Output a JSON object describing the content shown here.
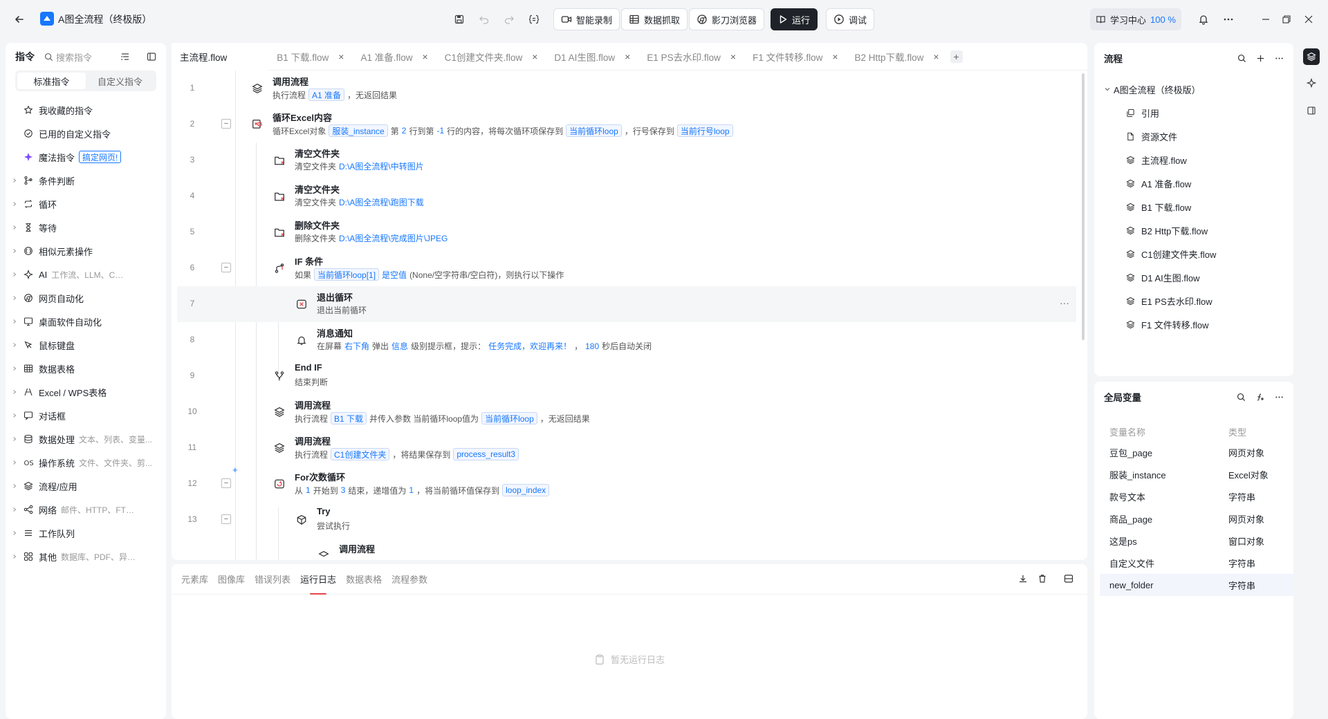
{
  "app": {
    "title": "A图全流程（终极版）",
    "toolbar": {
      "smart_record": "智能录制",
      "data_capture": "数据抓取",
      "browser": "影刀浏览器",
      "run": "运行",
      "debug": "调试"
    },
    "learn_center": "学习中心",
    "zoom": "100 %"
  },
  "left_panel": {
    "title": "指令",
    "search_placeholder": "搜索指令",
    "tabs": [
      "标准指令",
      "自定义指令"
    ],
    "categories": [
      {
        "label": "我收藏的指令",
        "icon": "star-icon",
        "sub": ""
      },
      {
        "label": "已用的自定义指令",
        "icon": "check-circle-icon",
        "sub": ""
      },
      {
        "label": "魔法指令",
        "icon": "sparkle-icon",
        "sub": "",
        "tag": "搞定网页!"
      },
      {
        "label": "条件判断",
        "icon": "branch-icon",
        "sub": ""
      },
      {
        "label": "循环",
        "icon": "loop-icon",
        "sub": ""
      },
      {
        "label": "等待",
        "icon": "hourglass-icon",
        "sub": ""
      },
      {
        "label": "相似元素操作",
        "icon": "similar-icon",
        "sub": ""
      },
      {
        "label": "AI",
        "icon": "ai-icon",
        "sub": "工作流、LLM、CUA..."
      },
      {
        "label": "网页自动化",
        "icon": "browser-icon",
        "sub": ""
      },
      {
        "label": "桌面软件自动化",
        "icon": "monitor-icon",
        "sub": ""
      },
      {
        "label": "鼠标键盘",
        "icon": "cursor-icon",
        "sub": ""
      },
      {
        "label": "数据表格",
        "icon": "table-icon",
        "sub": ""
      },
      {
        "label": "Excel / WPS表格",
        "icon": "excel-icon",
        "sub": ""
      },
      {
        "label": "对话框",
        "icon": "dialog-icon",
        "sub": ""
      },
      {
        "label": "数据处理",
        "icon": "database-icon",
        "sub": "文本、列表、变量..."
      },
      {
        "label": "操作系统",
        "icon": "os-icon",
        "sub": "文件、文件夹、剪..."
      },
      {
        "label": "流程/应用",
        "icon": "layers-icon",
        "sub": ""
      },
      {
        "label": "网络",
        "icon": "share-icon",
        "sub": "邮件、HTTP、FTP、群..."
      },
      {
        "label": "工作队列",
        "icon": "list-icon",
        "sub": ""
      },
      {
        "label": "其他",
        "icon": "grid-icon",
        "sub": "数据库、PDF、异常处..."
      }
    ]
  },
  "tabs": [
    {
      "label": "主流程.flow",
      "active": true,
      "closable": false
    },
    {
      "label": "B1 下载.flow",
      "active": false,
      "closable": true
    },
    {
      "label": "A1 准备.flow",
      "active": false,
      "closable": true
    },
    {
      "label": "C1创建文件夹.flow",
      "active": false,
      "closable": true
    },
    {
      "label": "D1 AI生图.flow",
      "active": false,
      "closable": true
    },
    {
      "label": "E1 PS去水印.flow",
      "active": false,
      "closable": true
    },
    {
      "label": "F1 文件转移.flow",
      "active": false,
      "closable": true
    },
    {
      "label": "B2 Http下载.flow",
      "active": false,
      "closable": true
    }
  ],
  "steps": [
    {
      "n": "1",
      "title": "调用流程",
      "desc": [
        [
          "t",
          "执行流程"
        ],
        [
          "tag",
          "A1 准备"
        ],
        [
          "t",
          "，无返回结果"
        ]
      ]
    },
    {
      "n": "2",
      "title": "循环Excel内容",
      "desc": [
        [
          "t",
          "循环Excel对象"
        ],
        [
          "tag",
          "服装_instance"
        ],
        [
          "t",
          "第"
        ],
        [
          "b",
          "2"
        ],
        [
          "t",
          "行到第"
        ],
        [
          "b",
          "-1"
        ],
        [
          "t",
          "行的内容，将每次循环项保存到"
        ],
        [
          "tag",
          "当前循环loop"
        ],
        [
          "t",
          "，行号保存到"
        ],
        [
          "tag",
          "当前行号loop"
        ]
      ]
    },
    {
      "n": "3",
      "title": "清空文件夹",
      "desc": [
        [
          "t",
          "清空文件夹"
        ],
        [
          "b",
          "D:\\A图全流程\\中转图片"
        ]
      ]
    },
    {
      "n": "4",
      "title": "清空文件夹",
      "desc": [
        [
          "t",
          "清空文件夹"
        ],
        [
          "b",
          "D:\\A图全流程\\跑图下载"
        ]
      ]
    },
    {
      "n": "5",
      "title": "删除文件夹",
      "desc": [
        [
          "t",
          "删除文件夹"
        ],
        [
          "b",
          "D:\\A图全流程\\完成图片\\JPEG"
        ]
      ]
    },
    {
      "n": "6",
      "title": "IF 条件",
      "desc": [
        [
          "t",
          "如果"
        ],
        [
          "tag",
          "当前循环loop[1]"
        ],
        [
          "b",
          "是空值"
        ],
        [
          "t",
          "(None/空字符串/空白符)，则执行以下操作"
        ]
      ]
    },
    {
      "n": "7",
      "title": "退出循环",
      "desc": [
        [
          "t",
          "退出当前循环"
        ]
      ]
    },
    {
      "n": "8",
      "title": "消息通知",
      "desc": [
        [
          "t",
          "在屏幕"
        ],
        [
          "b",
          "右下角"
        ],
        [
          "t",
          "弹出"
        ],
        [
          "b",
          "信息"
        ],
        [
          "t",
          "级别提示框，提示："
        ],
        [
          "b",
          "任务完成，欢迎再来！"
        ],
        [
          "t",
          "，"
        ],
        [
          "b",
          "180"
        ],
        [
          "t",
          "秒后自动关闭"
        ]
      ]
    },
    {
      "n": "9",
      "title": "End IF",
      "desc": [
        [
          "t",
          "结束判断"
        ]
      ]
    },
    {
      "n": "10",
      "title": "调用流程",
      "desc": [
        [
          "t",
          "执行流程"
        ],
        [
          "tag",
          "B1 下载"
        ],
        [
          "t",
          "并传入参数 当前循环loop值为"
        ],
        [
          "tag",
          "当前循环loop"
        ],
        [
          "t",
          "，无返回结果"
        ]
      ]
    },
    {
      "n": "11",
      "title": "调用流程",
      "desc": [
        [
          "t",
          "执行流程"
        ],
        [
          "tag",
          "C1创建文件夹"
        ],
        [
          "t",
          "，将结果保存到"
        ],
        [
          "tag",
          "process_result3"
        ]
      ]
    },
    {
      "n": "12",
      "title": "For次数循环",
      "desc": [
        [
          "t",
          "从"
        ],
        [
          "b",
          "1"
        ],
        [
          "t",
          "开始到"
        ],
        [
          "b",
          "3"
        ],
        [
          "t",
          "结束，递增值为"
        ],
        [
          "b",
          "1"
        ],
        [
          "t",
          "，将当前循环值保存到"
        ],
        [
          "tag",
          "loop_index"
        ]
      ]
    },
    {
      "n": "13",
      "title": "Try",
      "desc": [
        [
          "t",
          "尝试执行"
        ]
      ]
    },
    {
      "n": "",
      "title": "调用流程",
      "desc": []
    }
  ],
  "bottom": {
    "tabs": [
      "元素库",
      "图像库",
      "错误列表",
      "运行日志",
      "数据表格",
      "流程参数"
    ],
    "active": "运行日志",
    "empty_text": "暂无运行日志"
  },
  "flow_panel": {
    "title": "流程",
    "root": "A图全流程（终极版）",
    "items": [
      {
        "label": "引用",
        "icon": "reference-icon"
      },
      {
        "label": "资源文件",
        "icon": "file-icon"
      },
      {
        "label": "主流程.flow",
        "icon": "flow-icon"
      },
      {
        "label": "A1 准备.flow",
        "icon": "flow-icon"
      },
      {
        "label": "B1 下载.flow",
        "icon": "flow-icon"
      },
      {
        "label": "B2 Http下载.flow",
        "icon": "flow-icon"
      },
      {
        "label": "C1创建文件夹.flow",
        "icon": "flow-icon"
      },
      {
        "label": "D1 AI生图.flow",
        "icon": "flow-icon"
      },
      {
        "label": "E1 PS去水印.flow",
        "icon": "flow-icon"
      },
      {
        "label": "F1 文件转移.flow",
        "icon": "flow-icon"
      }
    ]
  },
  "vars_panel": {
    "title": "全局变量",
    "col_name": "变量名称",
    "col_type": "类型",
    "rows": [
      {
        "name": "豆包_page",
        "type": "网页对象"
      },
      {
        "name": "服装_instance",
        "type": "Excel对象"
      },
      {
        "name": "款号文本",
        "type": "字符串"
      },
      {
        "name": "商品_page",
        "type": "网页对象"
      },
      {
        "name": "这是ps",
        "type": "窗口对象"
      },
      {
        "name": "自定义文件",
        "type": "字符串"
      },
      {
        "name": "new_folder",
        "type": "字符串"
      }
    ]
  },
  "colors": {
    "accent": "#1677ff",
    "run_button": "#1f2329",
    "active_tab_underline": "#e5454b",
    "magic": "#7b4dff"
  }
}
